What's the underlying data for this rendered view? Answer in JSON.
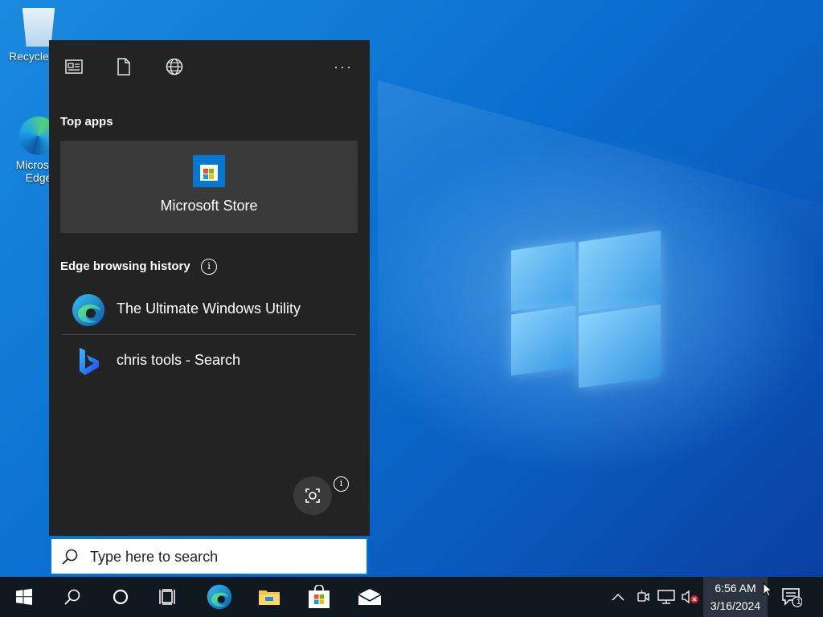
{
  "desktop": {
    "icons": [
      {
        "label": "Recycle Bin"
      },
      {
        "label": "Microsoft Edge"
      }
    ]
  },
  "start_panel": {
    "toolbar": {
      "icons": [
        "news-icon",
        "document-icon",
        "globe-icon",
        "more-icon"
      ],
      "more_label": "···"
    },
    "top_apps": {
      "title": "Top apps",
      "items": [
        {
          "name": "Microsoft Store",
          "icon": "store-icon"
        }
      ]
    },
    "history": {
      "title": "Edge browsing history",
      "info_glyph": "i",
      "items": [
        {
          "title": "The Ultimate Windows Utility",
          "icon": "edge-icon"
        },
        {
          "title": "chris tools - Search",
          "icon": "bing-icon"
        }
      ]
    },
    "visual_search": {
      "icon": "visual-search-icon",
      "info_glyph": "i"
    }
  },
  "search": {
    "placeholder": "Type here to search"
  },
  "taskbar": {
    "buttons": [
      "start-icon",
      "search-icon",
      "cortana-icon",
      "task-view-icon",
      "edge-icon",
      "file-explorer-icon",
      "store-icon",
      "mail-icon"
    ],
    "tray": [
      "chevron-up-icon",
      "meet-now-icon",
      "network-icon",
      "volume-muted-icon"
    ],
    "clock": {
      "time": "6:56 AM",
      "date": "3/16/2024"
    },
    "notifications": {
      "count": "1"
    }
  },
  "colors": {
    "accent": "#0078d4",
    "panel_bg": "#232323",
    "card_bg": "#3a3a3a",
    "taskbar_bg": "#101820"
  }
}
